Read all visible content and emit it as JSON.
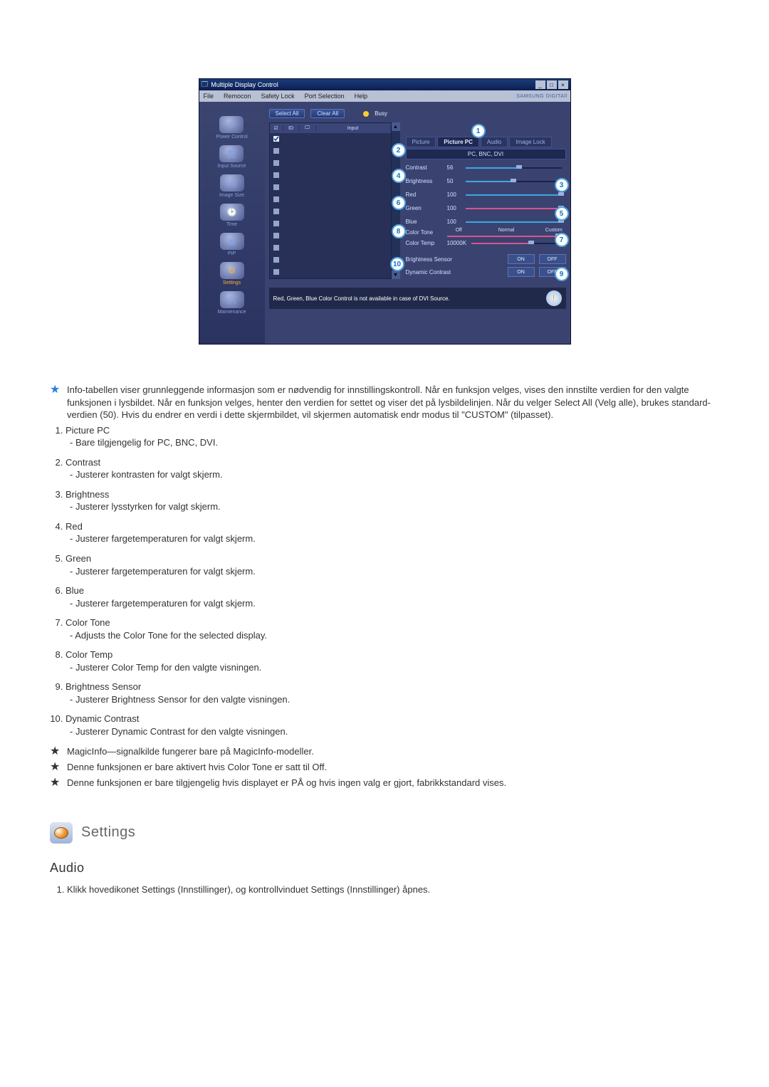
{
  "window": {
    "title": "Multiple Display Control",
    "menu": [
      "File",
      "Remocon",
      "Safety Lock",
      "Port Selection",
      "Help"
    ],
    "brand": "SAMSUNG DIGITAll"
  },
  "sidebar": {
    "items": [
      {
        "label": "Power Control"
      },
      {
        "label": "Input Source"
      },
      {
        "label": "Image Size"
      },
      {
        "label": "Time"
      },
      {
        "label": "PIP"
      },
      {
        "label": "Settings",
        "active": true
      },
      {
        "label": "Maintenance"
      }
    ]
  },
  "toolbar": {
    "select_all": "Select All",
    "clear_all": "Clear All",
    "busy": "Busy"
  },
  "list": {
    "headers": {
      "id": "ID",
      "input": "Input"
    },
    "row_count": 12
  },
  "tabs": [
    "Picture",
    "Picture PC",
    "Audio",
    "Image Lock"
  ],
  "active_tab": "Picture PC",
  "sub_header": "PC, BNC, DVI",
  "sliders": [
    {
      "label": "Contrast",
      "value": "56",
      "pct": 56,
      "color": "blue"
    },
    {
      "label": "Brightness",
      "value": "50",
      "pct": 50,
      "color": "blue"
    },
    {
      "label": "Red",
      "value": "100",
      "pct": 100,
      "color": "blue"
    },
    {
      "label": "Green",
      "value": "100",
      "pct": 100,
      "color": "pink"
    },
    {
      "label": "Blue",
      "value": "100",
      "pct": 100,
      "color": "blue"
    }
  ],
  "color_tone": {
    "label": "Color Tone",
    "options": [
      "Off",
      "",
      "Normal",
      "",
      "Custom"
    ],
    "pct": 100
  },
  "color_temp": {
    "label": "Color Temp",
    "value": "10000K",
    "pct": 65
  },
  "toggles": [
    {
      "label": "Brightness Sensor",
      "on": "ON",
      "off": "OFF"
    },
    {
      "label": "Dynamic Contrast",
      "on": "ON",
      "off": "OFF"
    }
  ],
  "footer_note": "Red, Green, Blue Color Control is not available in case of DVI Source.",
  "callouts": [
    "1",
    "2",
    "3",
    "4",
    "5",
    "6",
    "7",
    "8",
    "9",
    "10"
  ],
  "intro_para": "Info-tabellen viser grunnleggende informasjon som er nødvendig for innstillingskontroll. Når en funksjon velges, vises den innstilte verdien for den valgte funksjonen i lysbildet. Når en funksjon velges, henter den verdien for settet og viser det på lysbildelinjen. Når du velger Select All (Velg alle), brukes standard-verdien (50). Hvis du endrer en verdi i dette skjermbildet, vil skjermen automatisk endr modus til \"CUSTOM\" (tilpasset).",
  "items": [
    {
      "t": "Picture PC",
      "d": "Bare tilgjengelig for PC, BNC, DVI."
    },
    {
      "t": "Contrast",
      "d": "Justerer kontrasten for valgt skjerm."
    },
    {
      "t": "Brightness",
      "d": "Justerer lysstyrken for valgt skjerm."
    },
    {
      "t": "Red",
      "d": "Justerer fargetemperaturen for valgt skjerm."
    },
    {
      "t": "Green",
      "d": "Justerer fargetemperaturen for valgt skjerm."
    },
    {
      "t": "Blue",
      "d": "Justerer fargetemperaturen for valgt skjerm."
    },
    {
      "t": "Color Tone",
      "d": "Adjusts the Color Tone for the selected display."
    },
    {
      "t": "Color Temp",
      "d": "Justerer Color Temp for den valgte visningen."
    },
    {
      "t": "Brightness Sensor",
      "d": "Justerer Brightness Sensor for den valgte visningen."
    },
    {
      "t": "Dynamic Contrast",
      "d": "Justerer Dynamic Contrast for den valgte visningen."
    }
  ],
  "starnotes": [
    "MagicInfo—signalkilde fungerer bare på MagicInfo-modeller.",
    "Denne funksjonen er bare aktivert hvis Color Tone er satt til Off.",
    "Denne funksjonen er bare tilgjengelig hvis displayet er PÅ og hvis ingen valg er gjort, fabrikkstandard vises."
  ],
  "section_heading": "Settings",
  "audio_heading": "Audio",
  "audio_steps": [
    "Klikk hovedikonet Settings (Innstillinger), og kontrollvinduet Settings (Innstillinger) åpnes."
  ]
}
